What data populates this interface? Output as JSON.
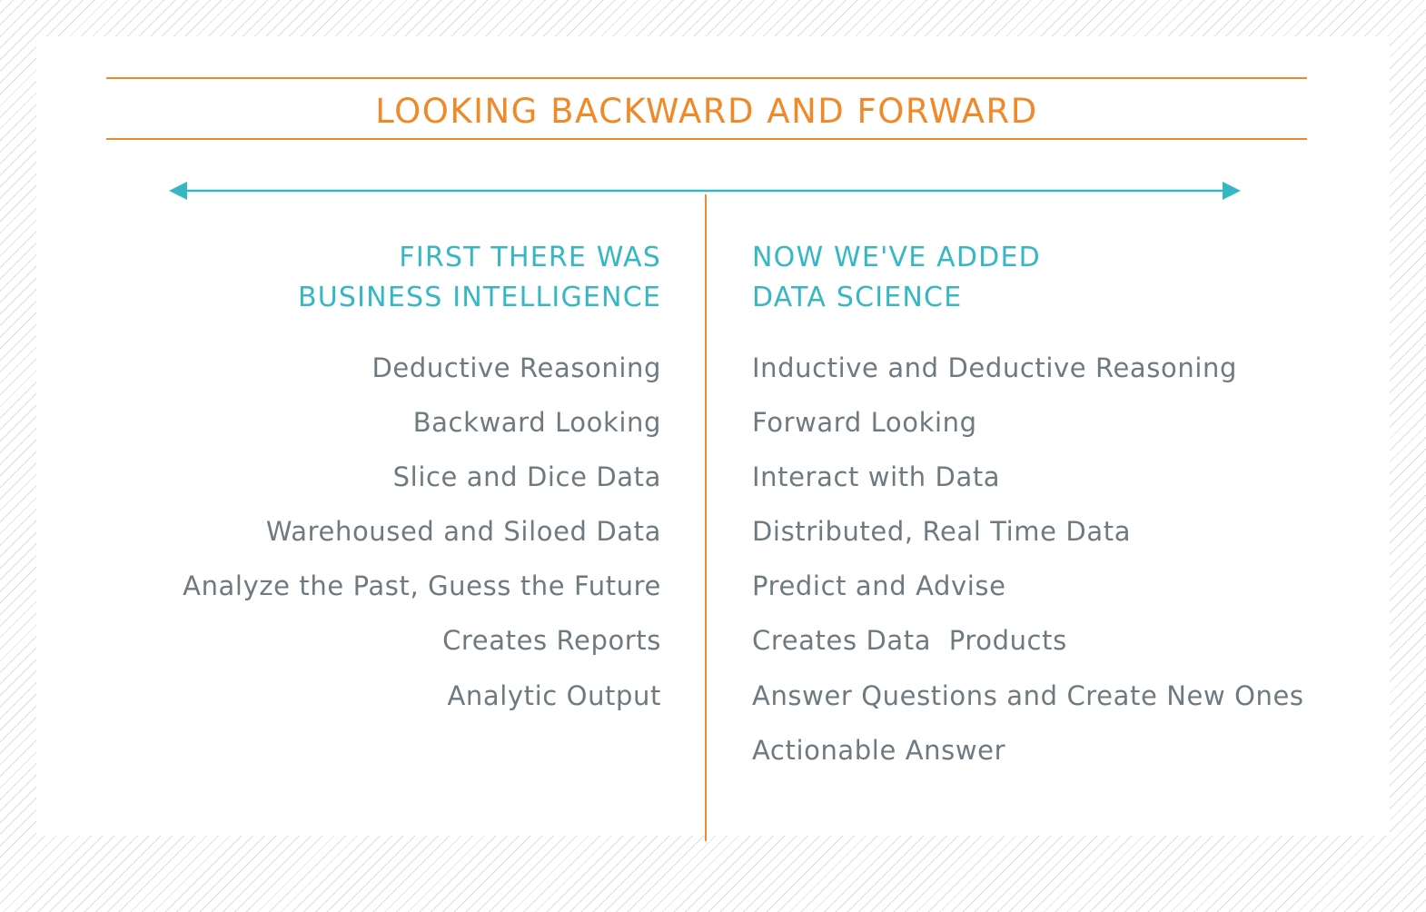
{
  "colors": {
    "accent_orange": "#f0892a",
    "accent_teal": "#35b7c4",
    "body_text": "#6f7a80"
  },
  "title": "LOOKING BACKWARD AND FORWARD",
  "left": {
    "heading_lines": [
      "FIRST THERE WAS",
      "BUSINESS INTELLIGENCE"
    ],
    "items": [
      "Deductive Reasoning",
      "Backward Looking",
      "Slice and Dice Data",
      "Warehoused and Siloed Data",
      "Analyze the Past, Guess the Future",
      "Creates Reports",
      "Analytic Output"
    ]
  },
  "right": {
    "heading_lines": [
      "NOW WE'VE ADDED",
      "DATA SCIENCE"
    ],
    "items": [
      "Inductive and Deductive Reasoning",
      "Forward Looking",
      "Interact with Data",
      "Distributed, Real Time Data",
      "Predict and Advise",
      "Creates Data  Products",
      "Answer Questions and Create New Ones",
      "Actionable Answer"
    ]
  }
}
